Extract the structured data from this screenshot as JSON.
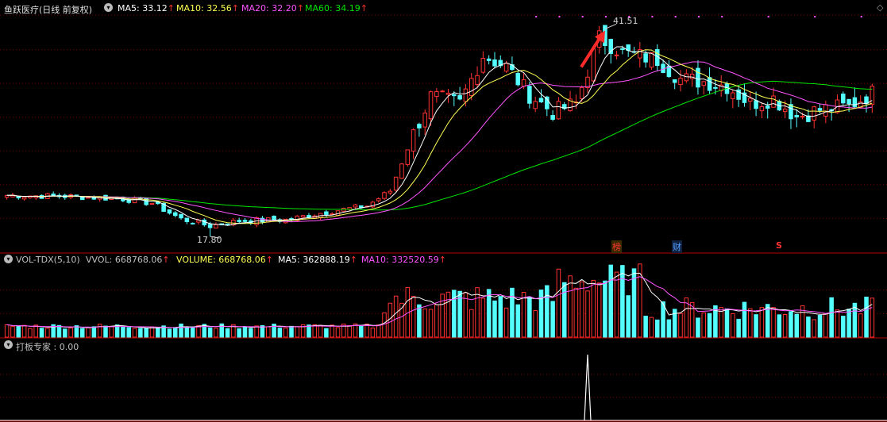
{
  "colors": {
    "background": "#000000",
    "up": "#ff3232",
    "down": "#54ffff",
    "ma5": "#ffffff",
    "ma10": "#ffff54",
    "ma20": "#ff54ff",
    "ma60": "#00e600",
    "grid": "#7a0000",
    "divider": "#b40000"
  },
  "price_panel": {
    "title": "鱼跃医疗(日线 前复权)",
    "indicators": [
      {
        "label": "MA5: 33.12",
        "arrow": "↑",
        "color": "#ffffff"
      },
      {
        "label": "MA10: 32.56",
        "arrow": "↑",
        "color": "#ffff54"
      },
      {
        "label": "MA20: 32.20",
        "arrow": "↑",
        "color": "#ff54ff"
      },
      {
        "label": "MA60: 34.19",
        "arrow": "↑",
        "color": "#00e600"
      }
    ],
    "high_label": "41.51",
    "low_label": "17.80",
    "markers": [
      {
        "text": "榜",
        "color": "#ff3232"
      },
      {
        "text": "财",
        "color": "#54a0ff"
      },
      {
        "text": "S",
        "color": "#ff3232"
      }
    ]
  },
  "volume_panel": {
    "indicators": [
      {
        "label": "VOL-TDX(5,10)",
        "arrow": "",
        "color": "#c0c0c0"
      },
      {
        "label": "VVOL: 668768.06",
        "arrow": "↑",
        "color": "#c0c0c0"
      },
      {
        "label": "VOLUME: 668768.06",
        "arrow": "↑",
        "color": "#ffff54"
      },
      {
        "label": "MA5: 362888.19",
        "arrow": "↑",
        "color": "#ffffff"
      },
      {
        "label": "MA10: 332520.59",
        "arrow": "↑",
        "color": "#ff54ff"
      }
    ]
  },
  "signal_panel": {
    "label": "打板专家 : 0.00"
  },
  "chart_data": {
    "type": "candlestick",
    "days": 150,
    "y_range": [
      16.0,
      43.0
    ],
    "anchor_closes": [
      [
        0,
        22.5
      ],
      [
        10,
        22.4
      ],
      [
        20,
        22.1
      ],
      [
        25,
        21.6
      ],
      [
        30,
        19.8
      ],
      [
        35,
        19.0
      ],
      [
        40,
        19.6
      ],
      [
        48,
        19.7
      ],
      [
        55,
        20.6
      ],
      [
        62,
        21.3
      ],
      [
        66,
        23.0
      ],
      [
        70,
        29.5
      ],
      [
        73,
        33.8
      ],
      [
        78,
        33.0
      ],
      [
        82,
        38.5
      ],
      [
        86,
        37.2
      ],
      [
        90,
        34.0
      ],
      [
        94,
        32.0
      ],
      [
        98,
        33.0
      ],
      [
        102,
        40.5
      ],
      [
        106,
        38.8
      ],
      [
        112,
        38.0
      ],
      [
        116,
        35.8
      ],
      [
        120,
        35.5
      ],
      [
        124,
        35.0
      ],
      [
        128,
        33.0
      ],
      [
        132,
        33.6
      ],
      [
        136,
        31.5
      ],
      [
        140,
        32.3
      ],
      [
        145,
        32.7
      ],
      [
        149,
        34.2
      ]
    ],
    "notable": {
      "high": 41.51,
      "low": 17.8
    },
    "ma_last": {
      "MA5": 33.12,
      "MA10": 32.56,
      "MA20": 32.2,
      "MA60": 34.19
    },
    "volume_last": {
      "VOLUME": 668768.06,
      "MA5": 362888.19,
      "MA10": 332520.59
    },
    "signal_spike_day": 100
  }
}
